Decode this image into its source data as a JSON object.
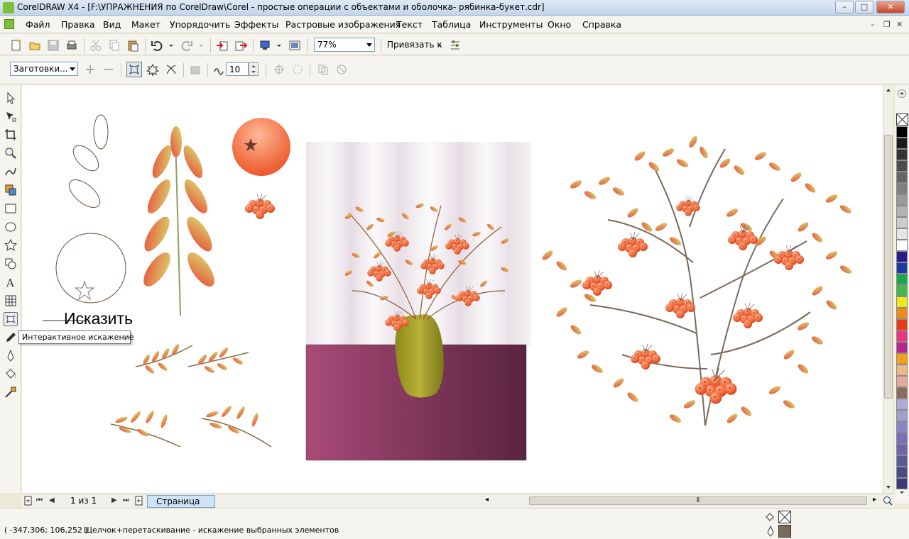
{
  "window": {
    "title": "CorelDRAW X4 - [F:\\УПРАЖНЕНИЯ по CorelDraw\\Corel - простые операции с объектами и оболочка- рябинка-букет.cdr]",
    "minimize": "–",
    "maximize": "□",
    "close": "✕"
  },
  "menu": {
    "items": [
      {
        "label": "Файл"
      },
      {
        "label": "Правка"
      },
      {
        "label": "Вид"
      },
      {
        "label": "Макет"
      },
      {
        "label": "Упорядочить"
      },
      {
        "label": "Эффекты"
      },
      {
        "label": "Растровые изображения"
      },
      {
        "label": "Текст"
      },
      {
        "label": "Таблица"
      },
      {
        "label": "Инструменты"
      },
      {
        "label": "Окно"
      },
      {
        "label": "Справка"
      }
    ],
    "mdi_min": "–",
    "mdi_restore": "❐",
    "mdi_close": "✕"
  },
  "standard_toolbar": {
    "zoom_value": "77%",
    "snap_label": "Привязать к"
  },
  "property_bar": {
    "presets_label": "Заготовки...",
    "amplitude_value": "10"
  },
  "callout": {
    "text": "Исказить"
  },
  "tooltip": {
    "text": "Интерактивное искажение"
  },
  "page_nav": {
    "count": "1 из 1",
    "tab": "Страница 1"
  },
  "status": {
    "coords": "( -347,306; 106,252 )",
    "message": "Щелчок+перетаскивание - искажение выбранных элементов"
  },
  "palette": {
    "colors": [
      "#000000",
      "#1a1a1a",
      "#333333",
      "#4d4d4d",
      "#666666",
      "#808080",
      "#999999",
      "#b3b3b3",
      "#cccccc",
      "#e6e6e6",
      "#ffffff",
      "#2e1a8a",
      "#1a3aa8",
      "#1aa84a",
      "#46b84a",
      "#f0e81a",
      "#f08a1a",
      "#e83a1a",
      "#e8367a",
      "#b8248a",
      "#f0a01a",
      "#f0b48a",
      "#e8a8a0",
      "#8a6e5a",
      "#b0a8d8",
      "#a0a0d0",
      "#8a84c8",
      "#7a70b8",
      "#6e64a8",
      "#5a5a98",
      "#4a4a88",
      "#3a3a78"
    ]
  },
  "artwork": {
    "rowan_fruit_color": "#f06a3c",
    "leaf_gradient_start": "#e8503a",
    "leaf_gradient_end": "#d8d870",
    "vase_color": "#a8a028",
    "table_color": "#8a3a68"
  }
}
